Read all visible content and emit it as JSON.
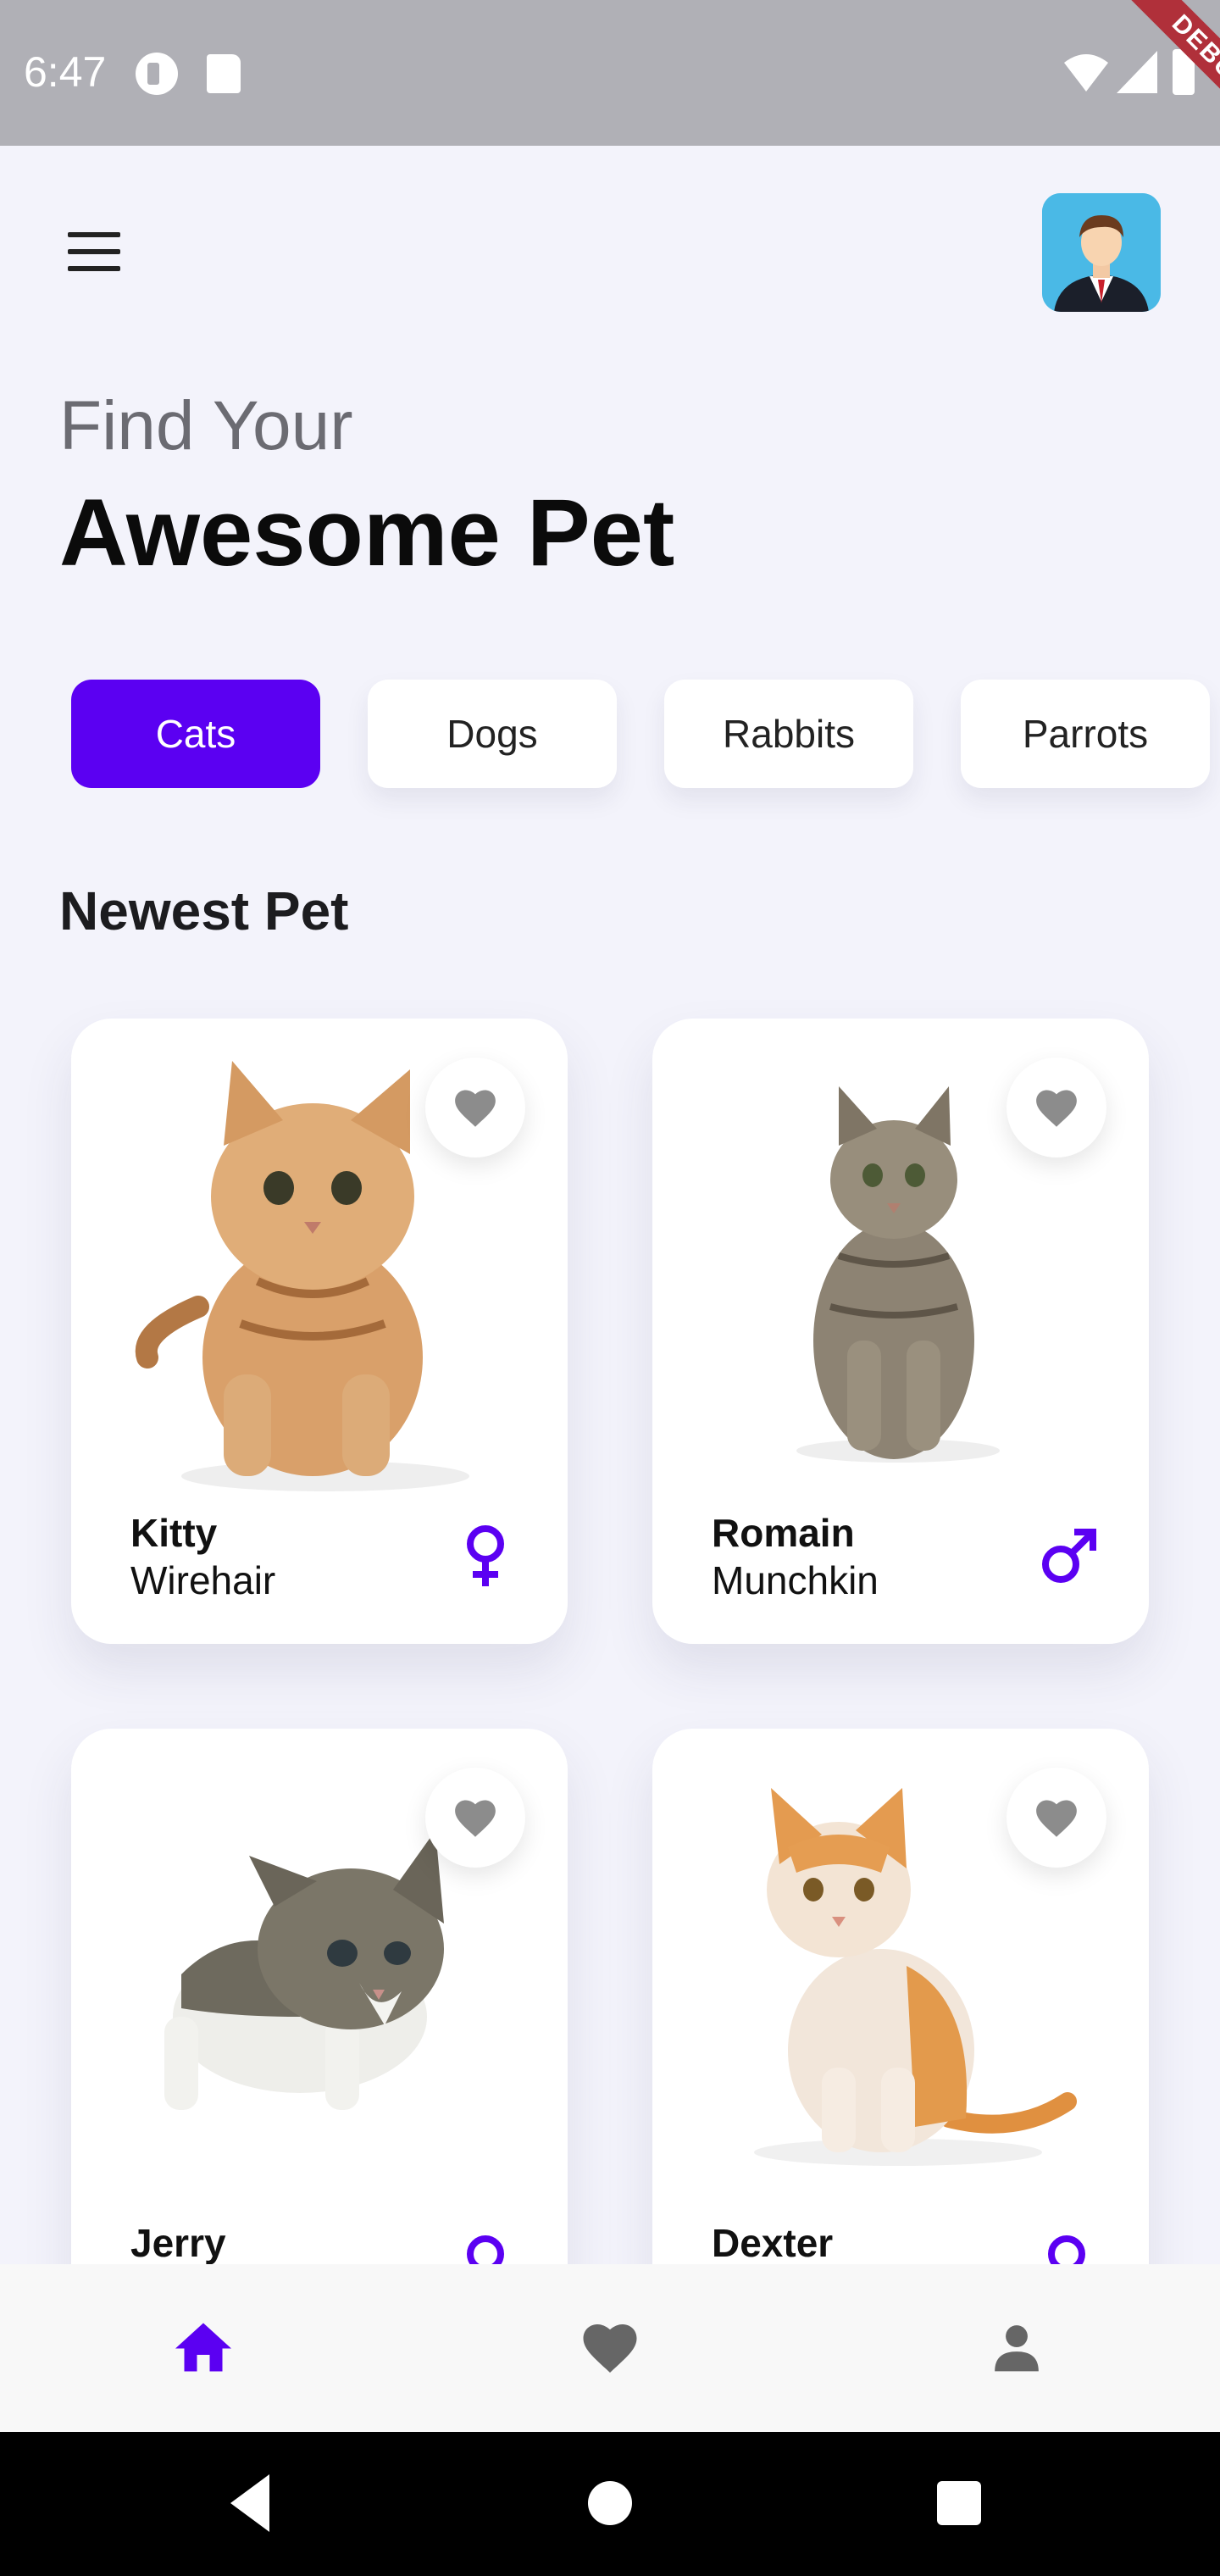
{
  "status_bar": {
    "time": "6:47",
    "debug_label": "DEBUG"
  },
  "header": {
    "title_light": "Find Your",
    "title_bold": "Awesome Pet"
  },
  "categories": [
    {
      "label": "Cats",
      "active": true
    },
    {
      "label": "Dogs",
      "active": false
    },
    {
      "label": "Rabbits",
      "active": false
    },
    {
      "label": "Parrots",
      "active": false
    }
  ],
  "section_title": "Newest Pet",
  "pets": [
    {
      "name": "Kitty",
      "breed": "Wirehair",
      "gender": "female-icon",
      "favorite_icon": "heart-icon"
    },
    {
      "name": "Romain",
      "breed": "Munchkin",
      "gender": "male-icon",
      "favorite_icon": "heart-icon"
    },
    {
      "name": "Jerry",
      "breed": "",
      "gender": "female-icon",
      "favorite_icon": "heart-icon"
    },
    {
      "name": "Dexter",
      "breed": "",
      "gender": "female-icon",
      "favorite_icon": "heart-icon"
    }
  ],
  "bottom_nav": [
    {
      "icon": "home-icon",
      "active": true
    },
    {
      "icon": "heart-icon",
      "active": false
    },
    {
      "icon": "person-icon",
      "active": false
    }
  ],
  "colors": {
    "accent": "#5b00f2",
    "background": "#f3f3fb",
    "inactive_icon": "#666666"
  }
}
